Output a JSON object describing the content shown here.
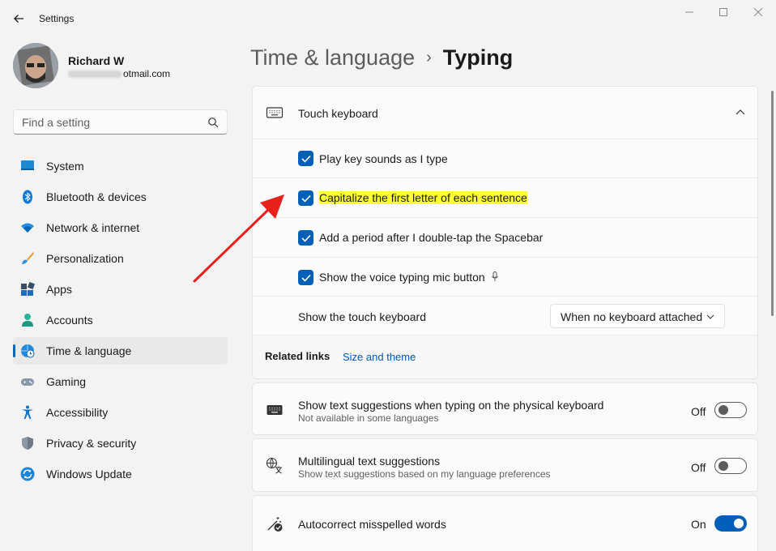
{
  "window": {
    "title": "Settings",
    "back_icon": "back-arrow-icon",
    "minimize_icon": "minimize-icon",
    "maximize_icon": "maximize-icon",
    "close_icon": "close-icon"
  },
  "profile": {
    "name": "Richard W",
    "email_suffix": "otmail.com"
  },
  "search": {
    "placeholder": "Find a setting",
    "icon": "search-icon"
  },
  "sidebar": {
    "items": [
      {
        "label": "System",
        "icon": "system-icon",
        "selected": false
      },
      {
        "label": "Bluetooth & devices",
        "icon": "bluetooth-icon",
        "selected": false
      },
      {
        "label": "Network & internet",
        "icon": "wifi-icon",
        "selected": false
      },
      {
        "label": "Personalization",
        "icon": "brush-icon",
        "selected": false
      },
      {
        "label": "Apps",
        "icon": "apps-icon",
        "selected": false
      },
      {
        "label": "Accounts",
        "icon": "person-icon",
        "selected": false
      },
      {
        "label": "Time & language",
        "icon": "globe-clock-icon",
        "selected": true
      },
      {
        "label": "Gaming",
        "icon": "gamepad-icon",
        "selected": false
      },
      {
        "label": "Accessibility",
        "icon": "accessibility-icon",
        "selected": false
      },
      {
        "label": "Privacy & security",
        "icon": "shield-icon",
        "selected": false
      },
      {
        "label": "Windows Update",
        "icon": "update-icon",
        "selected": false
      }
    ]
  },
  "breadcrumb": {
    "parent": "Time & language",
    "separator": "›",
    "current": "Typing"
  },
  "touch_keyboard": {
    "header": "Touch keyboard",
    "header_icon": "keyboard-icon",
    "expanded": true,
    "options": [
      {
        "label": "Play key sounds as I type",
        "checked": true,
        "highlighted": false
      },
      {
        "label": "Capitalize the first letter of each sentence",
        "checked": true,
        "highlighted": true
      },
      {
        "label": "Add a period after I double-tap the Spacebar",
        "checked": true,
        "highlighted": false
      },
      {
        "label": "Show the voice typing mic button",
        "checked": true,
        "highlighted": false,
        "icon": "microphone-icon"
      }
    ],
    "show_keyboard": {
      "label": "Show the touch keyboard",
      "value": "When no keyboard attached"
    },
    "related_links": {
      "label": "Related links",
      "link": "Size and theme"
    }
  },
  "settings": [
    {
      "title": "Show text suggestions when typing on the physical keyboard",
      "description": "Not available in some languages",
      "icon": "keyboard-icon",
      "state": "Off",
      "on": false
    },
    {
      "title": "Multilingual text suggestions",
      "description": "Show text suggestions based on my language preferences",
      "icon": "language-icon",
      "state": "Off",
      "on": false
    },
    {
      "title": "Autocorrect misspelled words",
      "description": "",
      "icon": "autocorrect-icon",
      "state": "On",
      "on": true
    }
  ],
  "colors": {
    "accent": "#005fb8",
    "highlight": "#ffff33",
    "annotation_arrow": "#e8211d",
    "background": "#f3f3f3",
    "card": "#fbfbfb"
  }
}
